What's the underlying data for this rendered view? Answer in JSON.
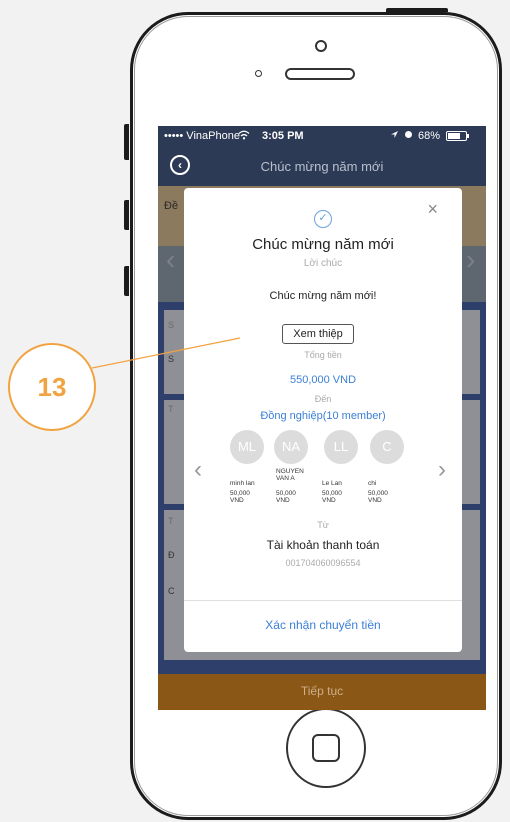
{
  "status_bar": {
    "carrier": "••••• VinaPhone",
    "time": "3:05 PM",
    "battery": "68%"
  },
  "navbar": {
    "title": "Chúc mừng năm mới"
  },
  "background": {
    "band_label": "Đề",
    "bottom_button": "Tiếp tục",
    "row_letters": [
      "S",
      "S",
      "T",
      "T",
      "Đ",
      "C"
    ]
  },
  "modal": {
    "title": "Chúc mừng năm mới",
    "subtitle": "Lời chúc",
    "message": "Chúc mừng năm mới!",
    "view_card_button": "Xem thiệp",
    "total_label": "Tổng tiền",
    "total_value": "550,000 VND",
    "to_label": "Đến",
    "group": "Đồng nghiệp(10 member)",
    "members": [
      {
        "initials": "ML",
        "name": "minh lan",
        "amount": "50,000",
        "currency": "VND"
      },
      {
        "initials": "NA",
        "name": "NGUYEN VAN A",
        "amount": "50,000",
        "currency": "VND"
      },
      {
        "initials": "LL",
        "name": "Le Lan",
        "amount": "50,000",
        "currency": "VND"
      },
      {
        "initials": "C",
        "name": "chi",
        "amount": "50,000",
        "currency": "VND"
      }
    ],
    "from_label": "Từ",
    "account_name": "Tài khoản thanh toán",
    "account_number": "001704060096554",
    "confirm_button": "Xác nhận chuyển tiền"
  },
  "callout": {
    "number": "13"
  },
  "colors": {
    "accent": "#3b7fd6",
    "callout": "#f2a341",
    "navbar": "#2d3a55",
    "bottom_bar": "#8a5716"
  },
  "icons": [
    "back-icon",
    "close-icon",
    "check-icon",
    "chevron-left-icon",
    "chevron-right-icon",
    "home-button-icon"
  ]
}
